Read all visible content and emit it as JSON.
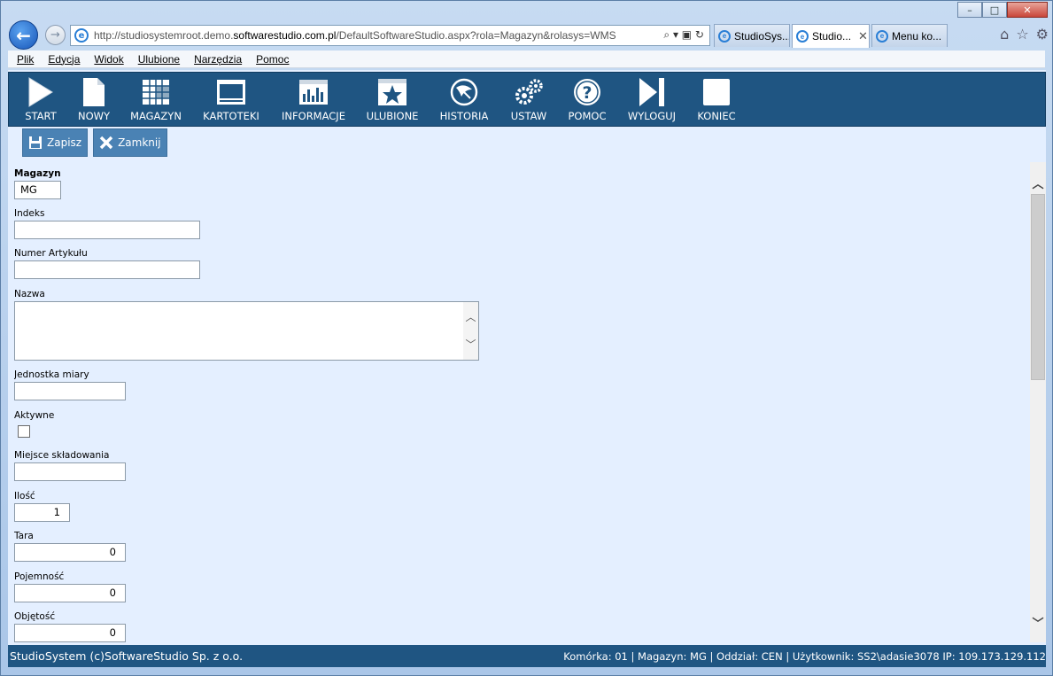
{
  "window": {
    "minimize": "–",
    "maximize": "□",
    "close": "✕"
  },
  "address": {
    "url_prefix": "http://studiosystemroot.demo.",
    "url_domain": "softwarestudio.com.pl",
    "url_suffix": "/DefaultSoftwareStudio.aspx?rola=Magazyn&rolasys=WMS",
    "tools": "⌕ ▾ ▣ ↻"
  },
  "tabs": [
    {
      "label": "StudioSys...",
      "active": false
    },
    {
      "label": "Studio...",
      "active": true,
      "close": "✕"
    },
    {
      "label": "Menu ko...",
      "active": false
    }
  ],
  "menubar": [
    "Plik",
    "Edycja",
    "Widok",
    "Ulubione",
    "Narzędzia",
    "Pomoc"
  ],
  "toolbar": {
    "items": [
      {
        "label": "START",
        "icon": "play-icon"
      },
      {
        "label": "NOWY",
        "icon": "document-icon"
      },
      {
        "label": "MAGAZYN",
        "icon": "grid-icon"
      },
      {
        "label": "KARTOTEKI",
        "icon": "window-icon"
      },
      {
        "label": "INFORMACJE",
        "icon": "chart-icon"
      },
      {
        "label": "ULUBIONE",
        "icon": "star-icon"
      },
      {
        "label": "HISTORIA",
        "icon": "history-icon"
      },
      {
        "label": "USTAW",
        "icon": "gears-icon"
      },
      {
        "label": "POMOC",
        "icon": "help-icon"
      },
      {
        "label": "WYLOGUJ",
        "icon": "logout-icon"
      },
      {
        "label": "KONIEC",
        "icon": "stop-icon"
      }
    ]
  },
  "actions": {
    "save_label": "Zapisz",
    "close_label": "Zamknij"
  },
  "form": {
    "magazyn": {
      "label": "Magazyn",
      "value": "MG"
    },
    "indeks": {
      "label": "Indeks",
      "value": ""
    },
    "numer_artykulu": {
      "label": "Numer Artykułu",
      "value": ""
    },
    "nazwa": {
      "label": "Nazwa",
      "value": ""
    },
    "jednostka_miary": {
      "label": "Jednostka miary",
      "value": ""
    },
    "aktywne": {
      "label": "Aktywne",
      "checked": false
    },
    "miejsce_skladowania": {
      "label": "Miejsce składowania",
      "value": ""
    },
    "ilosc": {
      "label": "Ilość",
      "value": "1"
    },
    "tara": {
      "label": "Tara",
      "value": "0"
    },
    "pojemnosc": {
      "label": "Pojemność",
      "value": "0"
    },
    "objetosc": {
      "label": "Objętość",
      "value": "0"
    }
  },
  "status": {
    "left": "StudioSystem (c)SoftwareStudio Sp. z o.o.",
    "right": "Komórka: 01 | Magazyn: MG | Oddział: CEN | Użytkownik: SS2\\adasie3078 IP: 109.173.129.112"
  },
  "colors": {
    "toolbar_bg": "#1f5582",
    "page_bg": "#e4efff",
    "action_btn": "#4a82b4"
  }
}
